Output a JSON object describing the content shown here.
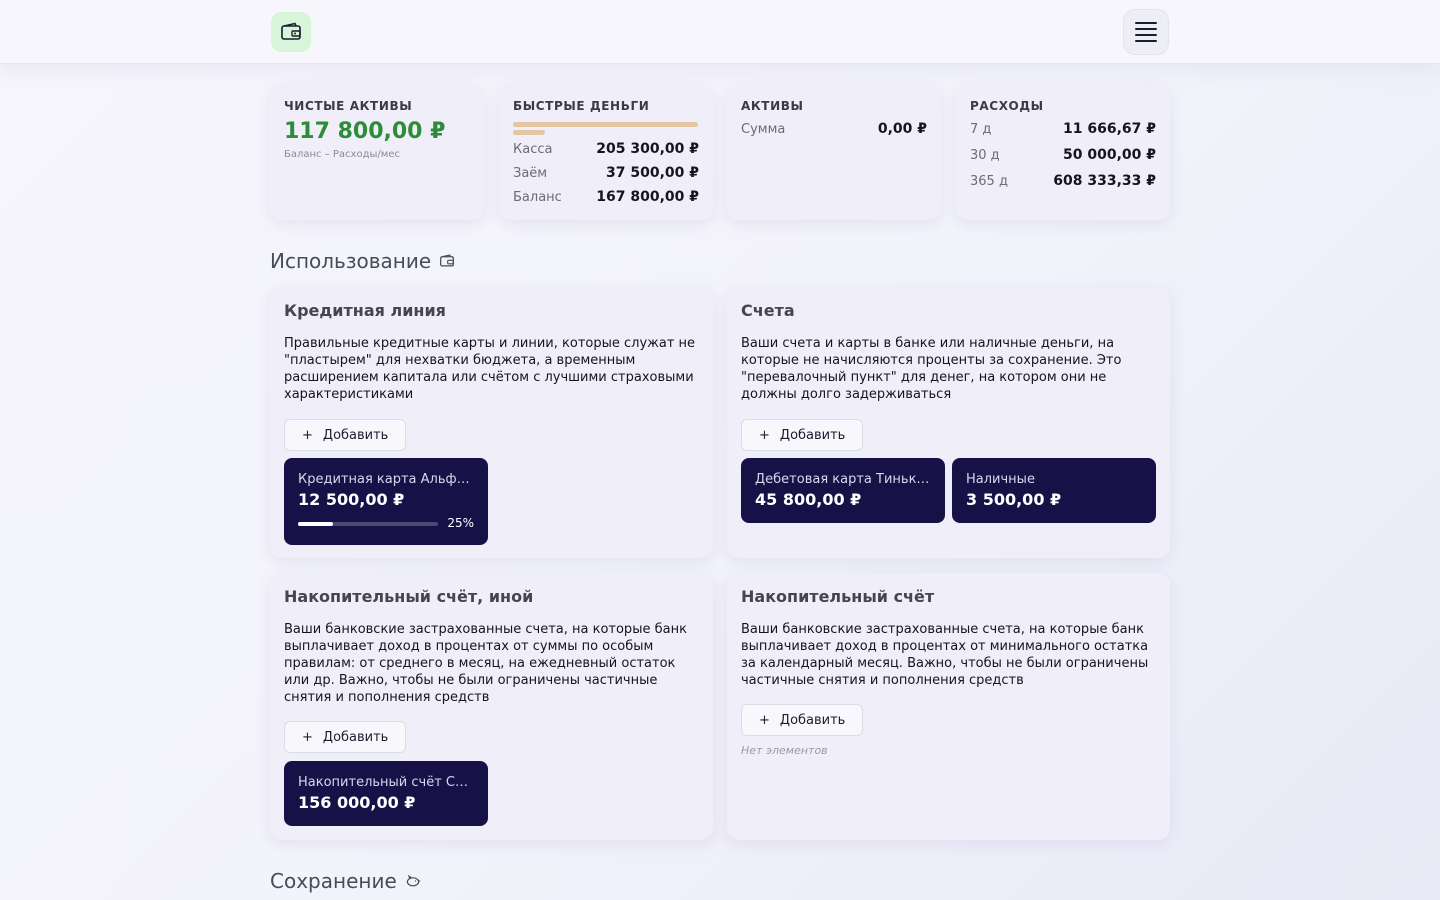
{
  "header": {
    "logo_icon": "wallet-icon",
    "menu_icon": "hamburger-menu-icon"
  },
  "stats": {
    "net_assets": {
      "title": "ЧИСТЫЕ АКТИВЫ",
      "value": "117 800,00 ₽",
      "note": "Баланс – Расходы/мес",
      "color": "#2e8b3a"
    },
    "quick_money": {
      "title": "БЫСТРЫЕ ДЕНЬГИ",
      "rows": [
        {
          "label": "Касса",
          "value": "205 300,00 ₽"
        },
        {
          "label": "Заём",
          "value": "37 500,00 ₽"
        },
        {
          "label": "Баланс",
          "value": "167 800,00 ₽"
        }
      ]
    },
    "assets": {
      "title": "АКТИВЫ",
      "rows": [
        {
          "label": "Сумма",
          "value": "0,00 ₽"
        }
      ]
    },
    "expenses": {
      "title": "РАСХОДЫ",
      "rows": [
        {
          "label": "7 д",
          "value": "11 666,67 ₽"
        },
        {
          "label": "30 д",
          "value": "50 000,00 ₽"
        },
        {
          "label": "365 д",
          "value": "608 333,33 ₽"
        }
      ]
    }
  },
  "sections": {
    "usage": {
      "title": "Использование",
      "icon": "wallet-icon"
    },
    "saving": {
      "title": "Сохранение",
      "icon": "piggy-bank-icon"
    }
  },
  "categories": [
    {
      "title": "Кредитная линия",
      "description": "Правильные кредитные карты и линии, которые служат не \"пластырем\" для нехватки бюджета, а временным расширением капитала или счётом с лучшими страховыми характеристиками",
      "add_label": "Добавить",
      "accounts": [
        {
          "name": "Кредитная карта Альфа-Банк",
          "amount": "12 500,00 ₽",
          "progress": 0.25,
          "progress_label": "25%"
        }
      ]
    },
    {
      "title": "Счета",
      "description": "Ваши счета и карты в банке или наличные деньги, на которые не начисляются проценты за сохранение. Это \"перевалочный пункт\" для денег, на котором они не должны долго задерживаться",
      "add_label": "Добавить",
      "accounts": [
        {
          "name": "Дебетовая карта Тинькофф",
          "amount": "45 800,00 ₽"
        },
        {
          "name": "Наличные",
          "amount": "3 500,00 ₽"
        }
      ]
    },
    {
      "title": "Накопительный счёт, иной",
      "description": "Ваши банковские застрахованные счета, на которые банк выплачивает доход в процентах от суммы по особым правилам: от среднего в месяц, на ежедневный остаток или др. Важно, чтобы не были ограничены частичные снятия и пополнения средств",
      "add_label": "Добавить",
      "accounts": [
        {
          "name": "Накопительный счёт Сбербанк",
          "amount": "156 000,00 ₽"
        }
      ]
    },
    {
      "title": "Накопительный счёт",
      "description": "Ваши банковские застрахованные счета, на которые банк выплачивает доход в процентах от минимального остатка за календарный месяц. Важно, чтобы не были ограничены частичные снятия и пополнения средств",
      "add_label": "Добавить",
      "empty_label": "Нет элементов",
      "accounts": []
    }
  ],
  "add_icon": "plus-icon"
}
